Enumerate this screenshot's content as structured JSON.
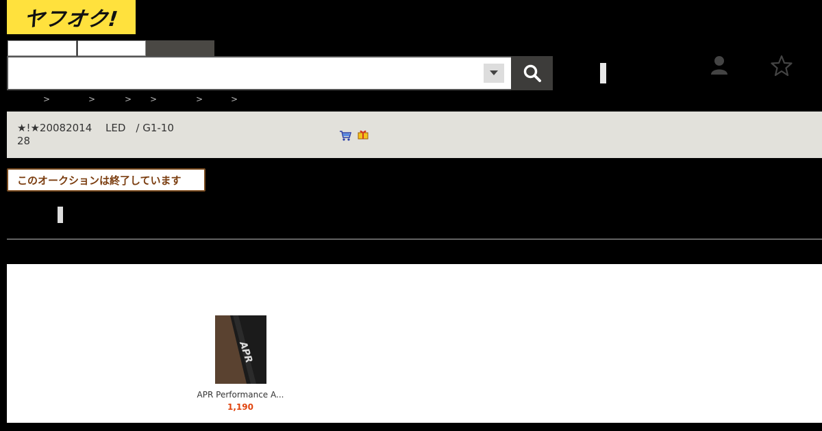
{
  "logo": {
    "text": "ヤフオク!"
  },
  "search": {
    "placeholder": ""
  },
  "breadcrumb": {
    "separators": [
      ">",
      ">",
      ">",
      ">",
      ">",
      ">"
    ]
  },
  "item": {
    "title_line1": "★!★20082014　 LED　/ G1-10",
    "title_line2": "28"
  },
  "auction": {
    "ended_notice": "このオークションは終了しています"
  },
  "recommended": {
    "products": [
      {
        "name": "APR Performance A...",
        "price": "1,190"
      }
    ]
  },
  "icons": {
    "search": "search-icon",
    "dropdown": "chevron-down-icon",
    "user": "user-icon",
    "watchlist": "star-icon",
    "cart": "cart-icon",
    "gift": "gift-icon"
  },
  "colors": {
    "logo_bg": "#ffe13d",
    "title_bar_bg": "#e2e1db",
    "ended_text": "#7a3c0e",
    "price": "#e0440e"
  }
}
